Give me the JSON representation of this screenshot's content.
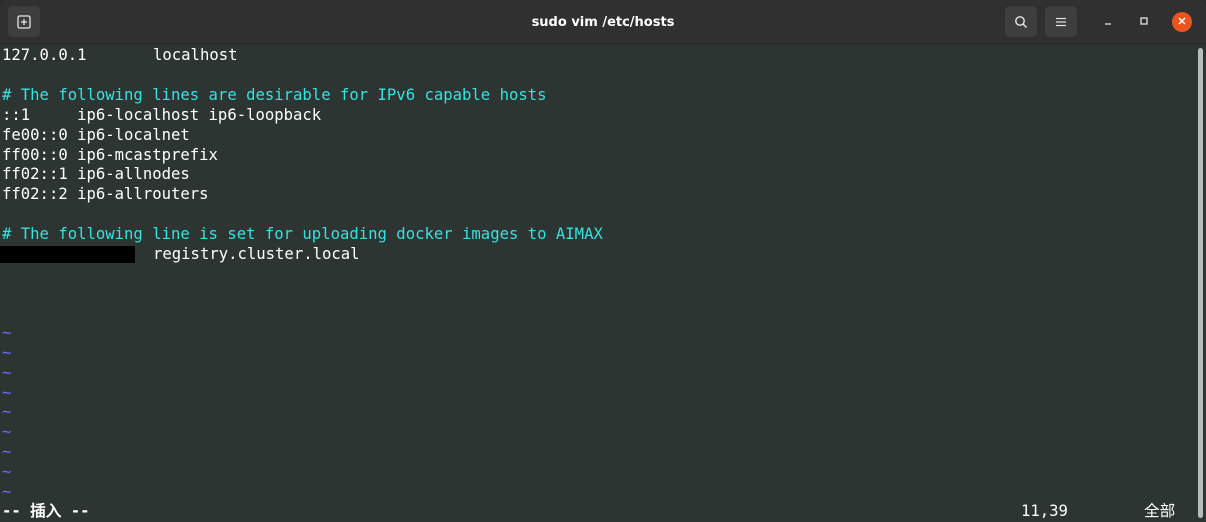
{
  "window": {
    "title": "sudo vim /etc/hosts"
  },
  "icons": {
    "new_tab": "new-tab-icon",
    "search": "search-icon",
    "menu": "hamburger-menu-icon",
    "minimize": "minimize-icon",
    "maximize": "maximize-icon",
    "close": "close-icon"
  },
  "colors": {
    "background": "#2c3532",
    "text": "#ffffff",
    "comment": "#34e2e2",
    "tilde": "#6b6bff",
    "close_button": "#e95420"
  },
  "editor": {
    "lines": [
      {
        "ip": "127.0.0.1",
        "host": "localhost"
      },
      {
        "comment": "# The following lines are desirable for IPv6 capable hosts"
      },
      {
        "text": "::1     ip6-localhost ip6-loopback"
      },
      {
        "text": "fe00::0 ip6-localnet"
      },
      {
        "text": "ff00::0 ip6-mcastprefix"
      },
      {
        "text": "ff02::1 ip6-allnodes"
      },
      {
        "text": "ff02::2 ip6-allrouters"
      },
      {
        "comment": "# The following line is set for uploading docker images to AIMAX"
      },
      {
        "host": "registry.cluster.local"
      }
    ],
    "tilde": "~"
  },
  "status": {
    "mode": "-- 插入 --",
    "position": "11,39",
    "scroll": "全部"
  }
}
